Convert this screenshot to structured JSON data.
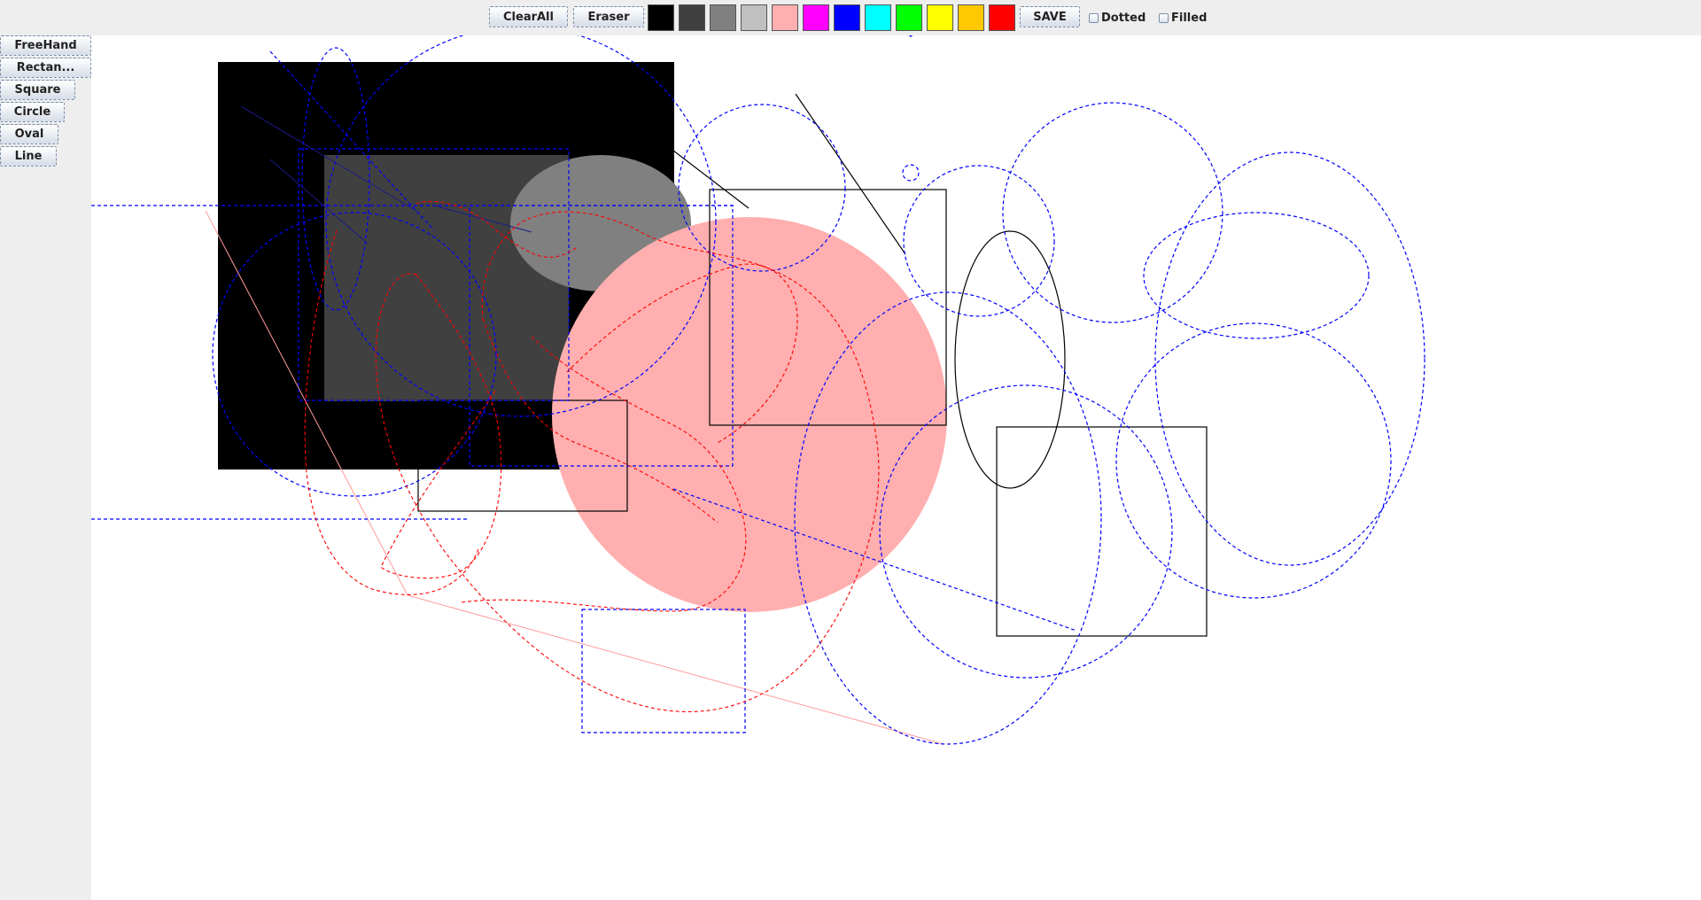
{
  "toolbar": {
    "clear_all_label": "ClearAll",
    "eraser_label": "Eraser",
    "save_label": "SAVE",
    "dotted_label": "Dotted",
    "filled_label": "Filled",
    "dotted_checked": false,
    "filled_checked": false
  },
  "palette": [
    {
      "name": "black",
      "color": "#000000"
    },
    {
      "name": "dark-gray",
      "color": "#404040"
    },
    {
      "name": "gray",
      "color": "#808080"
    },
    {
      "name": "light-gray",
      "color": "#c0c0c0"
    },
    {
      "name": "pink",
      "color": "#ffafaf"
    },
    {
      "name": "magenta",
      "color": "#ff00ff"
    },
    {
      "name": "blue",
      "color": "#0000ff"
    },
    {
      "name": "cyan",
      "color": "#00ffff"
    },
    {
      "name": "green",
      "color": "#00ff00"
    },
    {
      "name": "yellow",
      "color": "#ffff00"
    },
    {
      "name": "orange",
      "color": "#ffc800"
    },
    {
      "name": "red",
      "color": "#ff0000"
    }
  ],
  "tools": {
    "freehand_label": "FreeHand",
    "rectangle_label": "Rectan...",
    "square_label": "Square",
    "circle_label": "Circle",
    "oval_label": "Oval",
    "line_label": "Line"
  },
  "colors": {
    "window_bg": "#eeeeee",
    "canvas_bg": "#ffffff",
    "dotted_blue": "#0000ff",
    "dotted_red": "#ff0000",
    "filled_pink": "#ffafaf",
    "filled_gray": "#808080",
    "filled_dark_gray": "#404040",
    "filled_black": "#000000"
  }
}
